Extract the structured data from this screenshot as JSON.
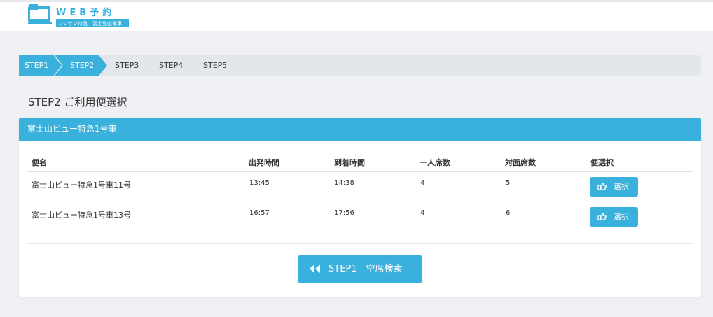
{
  "header": {
    "logo": {
      "title": "WEB予約",
      "subtitle": "フジサン特急 富士登山電車"
    }
  },
  "steps": [
    {
      "label": "STEP1",
      "active": true
    },
    {
      "label": "STEP2",
      "active": true
    },
    {
      "label": "STEP3",
      "active": false
    },
    {
      "label": "STEP4",
      "active": false
    },
    {
      "label": "STEP5",
      "active": false
    }
  ],
  "page": {
    "title": "STEP2 ご利用便選択"
  },
  "panel": {
    "heading": "富士山ビュー特急1号車",
    "columns": [
      "便名",
      "出発時間",
      "到着時間",
      "一人席数",
      "対面席数",
      "便選択"
    ],
    "rows": [
      {
        "name": "富士山ビュー特急1号車11号",
        "depart": "13:45",
        "arrive": "14:38",
        "single": "4",
        "facing": "5",
        "select_label": "選択"
      },
      {
        "name": "富士山ビュー特急1号車13号",
        "depart": "16:57",
        "arrive": "17:56",
        "single": "4",
        "facing": "6",
        "select_label": "選択"
      }
    ],
    "back_button": "STEP1　空席検索"
  },
  "colors": {
    "accent": "#3ab0dc",
    "background": "#eef0f3",
    "step_bar": "#e3e6ea"
  }
}
